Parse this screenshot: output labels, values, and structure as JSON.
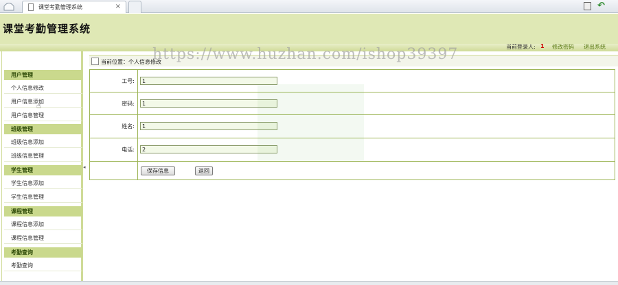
{
  "browser": {
    "tab_title": "课堂考勤管理系统",
    "tab_close": "×"
  },
  "header": {
    "title": "课堂考勤管理系统"
  },
  "userbar": {
    "login_label": "当前登录人:",
    "login_user": "1",
    "change_password": "修改密码",
    "logout": "退出系统"
  },
  "sidebar": {
    "groups": [
      {
        "title": "用户管理",
        "items": [
          "个人信息修改",
          "用户信息添加",
          "用户信息管理"
        ]
      },
      {
        "title": "班级管理",
        "items": [
          "班级信息添加",
          "班级信息管理"
        ]
      },
      {
        "title": "学生管理",
        "items": [
          "学生信息添加",
          "学生信息管理"
        ]
      },
      {
        "title": "课程管理",
        "items": [
          "课程信息添加",
          "课程信息管理"
        ]
      },
      {
        "title": "考勤查询",
        "items": [
          "考勤查询"
        ]
      }
    ]
  },
  "breadcrumb": {
    "text": "当前位置：个人信息修改"
  },
  "form": {
    "fields": [
      {
        "label": "工号:",
        "value": "1"
      },
      {
        "label": "密码:",
        "value": "1"
      },
      {
        "label": "姓名:",
        "value": "1"
      },
      {
        "label": "电话:",
        "value": "2"
      }
    ],
    "save_label": "保存信息",
    "back_label": "返回"
  },
  "watermark": {
    "text": "https://www.huzhan.com/ishop39397"
  },
  "icons": {
    "home": "home-tab-icon",
    "page": "page-icon",
    "back": "back-arrow-icon",
    "splitter": "collapse-arrow-icon",
    "cursor": "hand-cursor-icon"
  },
  "colors": {
    "header_bg": "#dfe8b5",
    "group_header_bg": "#cad98d",
    "border_green": "#9db556",
    "link_green": "#5a7a14"
  }
}
